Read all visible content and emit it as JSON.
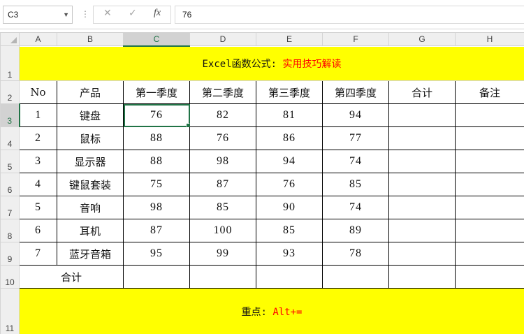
{
  "formula_bar": {
    "name_box": "C3",
    "cancel_icon": "✕",
    "enter_icon": "✓",
    "fx_label": "fx",
    "formula_value": "76"
  },
  "columns": [
    "A",
    "B",
    "C",
    "D",
    "E",
    "F",
    "G",
    "H"
  ],
  "rows": [
    "1",
    "2",
    "3",
    "4",
    "5",
    "6",
    "7",
    "8",
    "9",
    "10",
    "11"
  ],
  "title": {
    "prefix": "Excel函数公式: ",
    "highlight": "实用技巧解读"
  },
  "table": {
    "headers": [
      "No",
      "产品",
      "第一季度",
      "第二季度",
      "第三季度",
      "第四季度",
      "合计",
      "备注"
    ],
    "data": [
      [
        "1",
        "键盘",
        "76",
        "82",
        "81",
        "94",
        "",
        ""
      ],
      [
        "2",
        "鼠标",
        "88",
        "76",
        "86",
        "77",
        "",
        ""
      ],
      [
        "3",
        "显示器",
        "88",
        "98",
        "94",
        "74",
        "",
        ""
      ],
      [
        "4",
        "键鼠套装",
        "75",
        "87",
        "76",
        "85",
        "",
        ""
      ],
      [
        "5",
        "音响",
        "98",
        "85",
        "90",
        "74",
        "",
        ""
      ],
      [
        "6",
        "耳机",
        "87",
        "100",
        "85",
        "89",
        "",
        ""
      ],
      [
        "7",
        "蓝牙音箱",
        "95",
        "99",
        "93",
        "78",
        "",
        ""
      ]
    ],
    "total_label": "合计"
  },
  "footer": {
    "prefix": "重点: ",
    "highlight": "Alt+="
  },
  "colors": {
    "yellow_fill": "#ffff00",
    "red_text": "#ff0000",
    "selection_green": "#217346"
  }
}
